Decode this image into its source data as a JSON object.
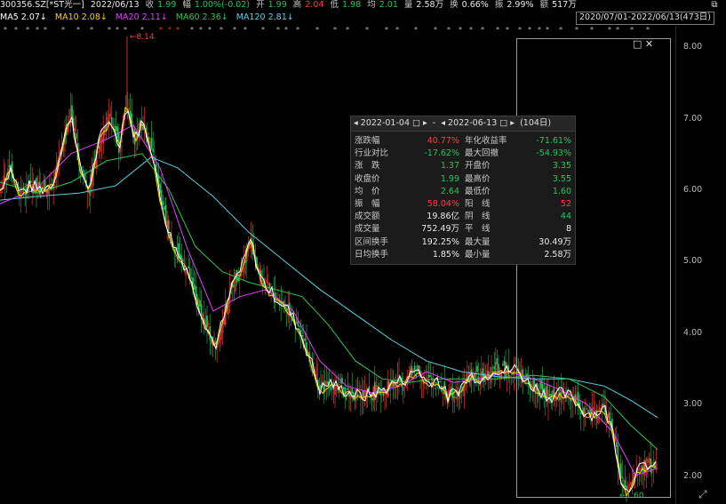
{
  "topbar": {
    "code": "300356.SZ[*ST光一]",
    "date": "2022/06/13",
    "close_label": "收",
    "close": "1.99",
    "chg_label": "幅",
    "chg": "1.00%(-0.02)",
    "open_label": "开",
    "open": "1.99",
    "high_label": "高",
    "high": "2.04",
    "low_label": "低",
    "low": "1.98",
    "avg_label": "均",
    "avg": "2.01",
    "vol_label": "量",
    "vol": "2.58万",
    "turn_label": "换",
    "turn": "0.66%",
    "amp_label": "振",
    "amp": "2.99%",
    "amt_label": "额",
    "amt": "517万",
    "daterange": "2020/07/01-2022/06/13(473日)",
    "corner_icon": "restore-window-icon"
  },
  "ma_bar": {
    "ma5": "MA5 2.07↓",
    "ma10": "MA10 2.08↓",
    "ma20": "MA20 2.11↓",
    "ma60": "MA60 2.36↓",
    "ma120": "MA120 2.81↓"
  },
  "colors": {
    "up": "#ff3b3b",
    "down": "#22c55e",
    "ma5": "#ffffff",
    "ma10": "#f5d000",
    "ma20": "#e040fb",
    "ma60": "#2ec84a",
    "ma120": "#5ad0e6"
  },
  "chart_data": {
    "type": "line",
    "y_ticks": [
      "8.00",
      "7.00",
      "6.00",
      "5.00",
      "4.00",
      "3.00",
      "2.00"
    ],
    "ylim": [
      1.6,
      8.3
    ],
    "annotations": {
      "high": "8.14",
      "low": "1.60"
    },
    "series_close_path": [
      [
        0,
        6.0
      ],
      [
        12,
        6.3
      ],
      [
        22,
        5.95
      ],
      [
        34,
        6.05
      ],
      [
        48,
        6.0
      ],
      [
        60,
        6.1
      ],
      [
        72,
        6.7
      ],
      [
        80,
        7.1
      ],
      [
        90,
        6.3
      ],
      [
        100,
        6.0
      ],
      [
        112,
        6.7
      ],
      [
        124,
        7.0
      ],
      [
        134,
        6.6
      ],
      [
        142,
        7.2
      ],
      [
        152,
        6.7
      ],
      [
        160,
        6.95
      ],
      [
        170,
        6.6
      ],
      [
        180,
        5.9
      ],
      [
        190,
        5.4
      ],
      [
        200,
        5.1
      ],
      [
        210,
        4.9
      ],
      [
        220,
        4.5
      ],
      [
        232,
        4.1
      ],
      [
        242,
        3.8
      ],
      [
        252,
        4.2
      ],
      [
        262,
        4.7
      ],
      [
        272,
        4.9
      ],
      [
        282,
        5.3
      ],
      [
        292,
        4.8
      ],
      [
        302,
        4.6
      ],
      [
        314,
        4.45
      ],
      [
        326,
        4.3
      ],
      [
        338,
        4.0
      ],
      [
        350,
        3.6
      ],
      [
        360,
        3.2
      ],
      [
        372,
        3.3
      ],
      [
        384,
        3.2
      ],
      [
        396,
        3.15
      ],
      [
        408,
        3.1
      ],
      [
        420,
        3.15
      ],
      [
        432,
        3.2
      ],
      [
        444,
        3.3
      ],
      [
        458,
        3.35
      ],
      [
        470,
        3.5
      ],
      [
        480,
        3.3
      ],
      [
        492,
        3.35
      ],
      [
        504,
        3.1
      ],
      [
        516,
        3.2
      ],
      [
        530,
        3.4
      ],
      [
        544,
        3.35
      ],
      [
        556,
        3.5
      ],
      [
        568,
        3.45
      ],
      [
        580,
        3.5
      ],
      [
        594,
        3.3
      ],
      [
        606,
        3.2
      ],
      [
        618,
        3.1
      ],
      [
        630,
        3.15
      ],
      [
        644,
        3.1
      ],
      [
        656,
        2.9
      ],
      [
        668,
        2.85
      ],
      [
        680,
        2.95
      ],
      [
        690,
        2.6
      ],
      [
        698,
        2.0
      ],
      [
        706,
        1.75
      ],
      [
        716,
        2.05
      ],
      [
        728,
        2.15
      ],
      [
        740,
        2.1
      ]
    ],
    "ma20_path": [
      [
        0,
        5.8
      ],
      [
        40,
        6.0
      ],
      [
        80,
        6.5
      ],
      [
        120,
        6.7
      ],
      [
        150,
        6.9
      ],
      [
        180,
        6.3
      ],
      [
        210,
        5.2
      ],
      [
        240,
        4.3
      ],
      [
        270,
        4.5
      ],
      [
        300,
        4.6
      ],
      [
        330,
        4.3
      ],
      [
        360,
        3.6
      ],
      [
        390,
        3.25
      ],
      [
        420,
        3.15
      ],
      [
        450,
        3.25
      ],
      [
        480,
        3.45
      ],
      [
        510,
        3.3
      ],
      [
        540,
        3.35
      ],
      [
        570,
        3.45
      ],
      [
        600,
        3.35
      ],
      [
        630,
        3.2
      ],
      [
        660,
        3.0
      ],
      [
        690,
        2.6
      ],
      [
        715,
        2.0
      ],
      [
        740,
        2.1
      ]
    ],
    "ma60_path": [
      [
        0,
        6.1
      ],
      [
        40,
        5.95
      ],
      [
        80,
        6.1
      ],
      [
        120,
        6.4
      ],
      [
        160,
        6.5
      ],
      [
        190,
        6.0
      ],
      [
        220,
        5.2
      ],
      [
        250,
        4.85
      ],
      [
        280,
        4.7
      ],
      [
        310,
        4.6
      ],
      [
        340,
        4.5
      ],
      [
        370,
        4.1
      ],
      [
        400,
        3.6
      ],
      [
        430,
        3.35
      ],
      [
        460,
        3.3
      ],
      [
        490,
        3.35
      ],
      [
        520,
        3.35
      ],
      [
        560,
        3.35
      ],
      [
        600,
        3.4
      ],
      [
        640,
        3.35
      ],
      [
        680,
        3.1
      ],
      [
        710,
        2.7
      ],
      [
        740,
        2.36
      ]
    ],
    "ma120_path": [
      [
        0,
        5.85
      ],
      [
        40,
        5.9
      ],
      [
        90,
        5.95
      ],
      [
        130,
        6.05
      ],
      [
        170,
        6.45
      ],
      [
        200,
        6.3
      ],
      [
        240,
        5.9
      ],
      [
        280,
        5.4
      ],
      [
        320,
        5.0
      ],
      [
        360,
        4.6
      ],
      [
        400,
        4.25
      ],
      [
        440,
        3.9
      ],
      [
        480,
        3.6
      ],
      [
        520,
        3.45
      ],
      [
        560,
        3.38
      ],
      [
        600,
        3.35
      ],
      [
        640,
        3.35
      ],
      [
        680,
        3.25
      ],
      [
        710,
        3.05
      ],
      [
        740,
        2.81
      ]
    ]
  },
  "panel": {
    "start_date": "2022-01-04",
    "end_date": "2022-06-13",
    "days": "(104日)",
    "rows": [
      {
        "l1": "涨跌幅",
        "v1": "40.77%",
        "c1": "red",
        "l2": "年化收益率",
        "v2": "-71.61%",
        "c2": "green"
      },
      {
        "l1": "行业对比",
        "v1": "-17.62%",
        "c1": "green",
        "l2": "最大回撤",
        "v2": "-54.93%",
        "c2": "green"
      },
      {
        "l1": "涨　跌",
        "v1": "1.37",
        "c1": "green",
        "l2": "开盘价",
        "v2": "3.35",
        "c2": "green"
      },
      {
        "l1": "收盘价",
        "v1": "1.99",
        "c1": "green",
        "l2": "最高价",
        "v2": "3.55",
        "c2": "green"
      },
      {
        "l1": "均　价",
        "v1": "2.64",
        "c1": "green",
        "l2": "最低价",
        "v2": "1.60",
        "c2": "green"
      },
      {
        "l1": "振　幅",
        "v1": "58.04%",
        "c1": "red",
        "l2": "阳　线",
        "v2": "52",
        "c2": "red"
      },
      {
        "l1": "成交额",
        "v1": "19.86亿",
        "c1": "white",
        "l2": "阴　线",
        "v2": "44",
        "c2": "green"
      },
      {
        "l1": "成交量",
        "v1": "752.49万",
        "c1": "white",
        "l2": "平　线",
        "v2": "8",
        "c2": "white"
      },
      {
        "l1": "区间换手",
        "v1": "192.25%",
        "c1": "white",
        "l2": "最大量",
        "v2": "30.49万",
        "c2": "white"
      },
      {
        "l1": "日均换手",
        "v1": "1.85%",
        "c1": "white",
        "l2": "最小量",
        "v2": "2.58万",
        "c2": "white"
      }
    ]
  }
}
